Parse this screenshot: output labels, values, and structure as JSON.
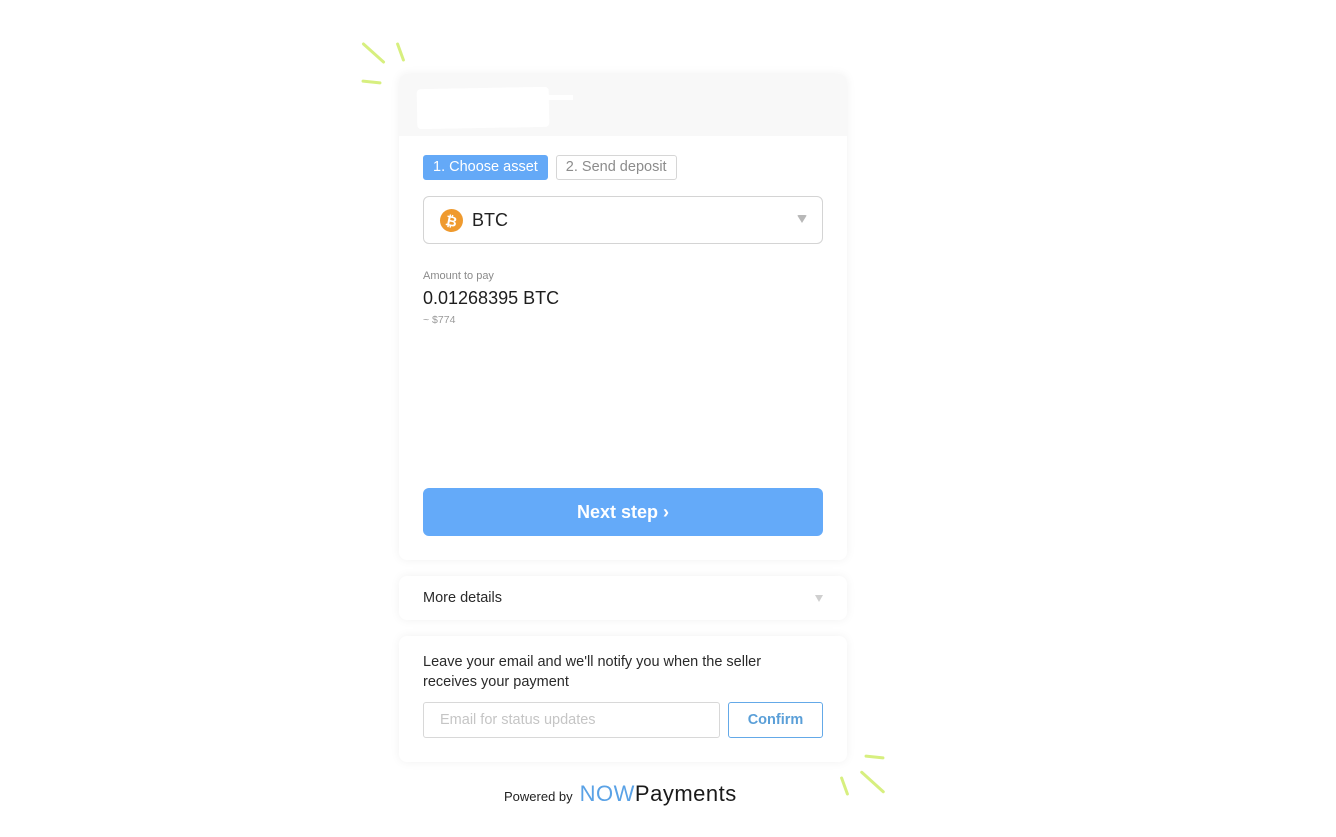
{
  "header": {
    "title": ""
  },
  "steps": [
    {
      "label": "1. Choose asset",
      "active": true
    },
    {
      "label": "2. Send deposit",
      "active": false
    }
  ],
  "asset_select": {
    "icon": "bitcoin-icon",
    "icon_glyph": "₿",
    "selected": "BTC"
  },
  "amount": {
    "label": "Amount to pay",
    "value": "0.01268395 BTC",
    "fiat": "~ $774"
  },
  "next_button": {
    "label": "Next step ›"
  },
  "more_details": {
    "label": "More details"
  },
  "email": {
    "description": "Leave your email and we'll notify you when the seller receives your payment",
    "placeholder": "Email for status updates",
    "value": "",
    "confirm_label": "Confirm"
  },
  "footer": {
    "powered_by": "Powered by",
    "brand_part1": "NOW",
    "brand_part2": "Payments"
  },
  "colors": {
    "accent": "#64aaf9",
    "bitcoin": "#ef9a2e",
    "spark": "#d7ef7f",
    "brand_blue": "#5aa2e6"
  }
}
